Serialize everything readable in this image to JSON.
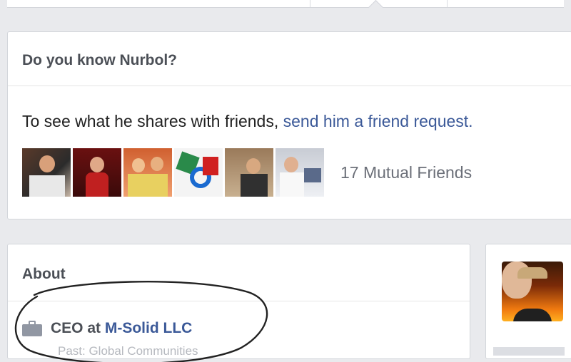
{
  "suggestion": {
    "title": "Do you know Nurbol?",
    "request_text": "To see what he shares with friends, ",
    "request_link": "send him a friend request.",
    "mutual_friends": "17 Mutual Friends",
    "mutual_thumbnails": 6
  },
  "about": {
    "title": "About",
    "work_prefix": "CEO at ",
    "work_company": "M-Solid LLC",
    "work_sub": "Past: Global Communities"
  },
  "icons": {
    "work": "briefcase-icon"
  },
  "colors": {
    "link": "#3b5998",
    "page_bg": "#e9eaed",
    "secondary_text": "#6b6f78",
    "annotation": "#222222"
  }
}
